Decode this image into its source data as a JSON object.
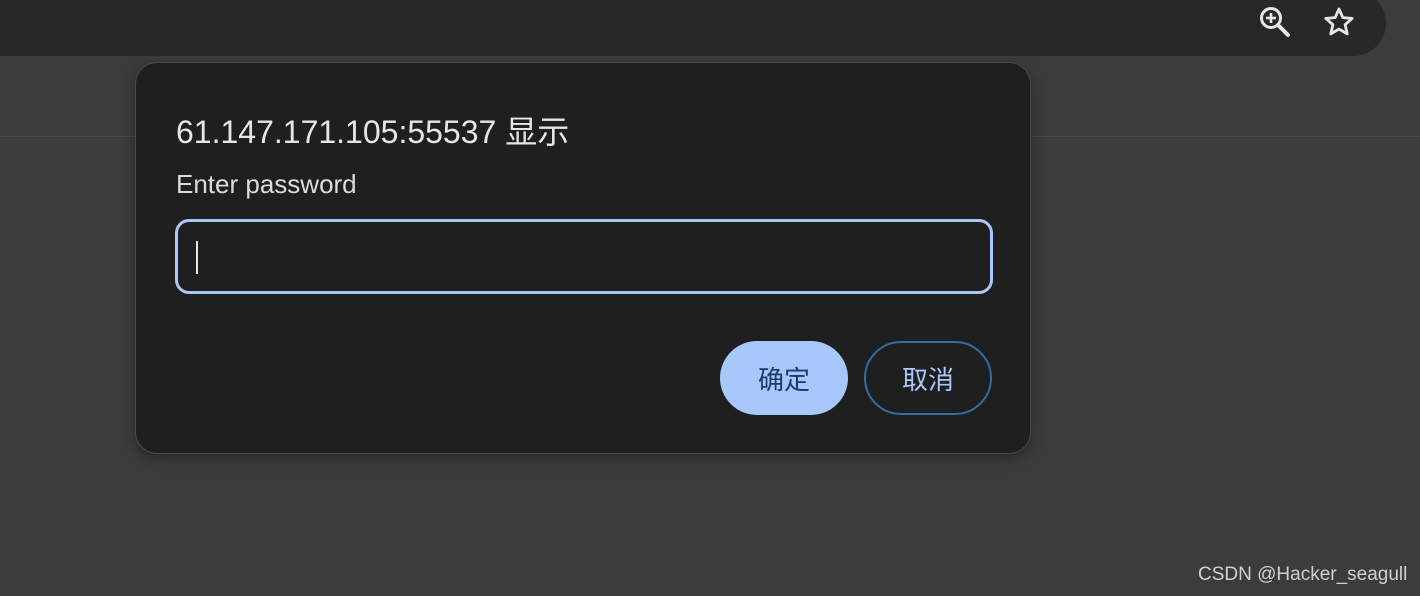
{
  "browser": {
    "icons": {
      "zoom": "zoom-in-icon",
      "bookmark": "star-icon"
    }
  },
  "dialog": {
    "title": "61.147.171.105:55537 显示",
    "message": "Enter password",
    "input_value": "",
    "ok_label": "确定",
    "cancel_label": "取消"
  },
  "colors": {
    "background": "#3c3c3c",
    "dialog_bg": "#1f1f1f",
    "accent": "#a8c7fa",
    "cancel_border": "#2f6fa8"
  },
  "watermark": "CSDN @Hacker_seagull"
}
